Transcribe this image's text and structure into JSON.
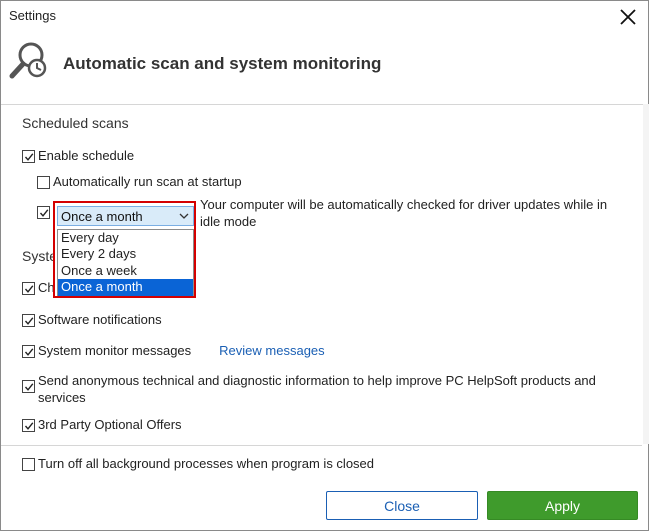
{
  "window": {
    "title": "Settings"
  },
  "header": {
    "title": "Automatic scan and system monitoring",
    "icon": "magnifier-clock-icon"
  },
  "scheduled": {
    "section_title": "Scheduled scans",
    "enable_schedule": {
      "label": "Enable schedule",
      "checked": true
    },
    "run_at_startup": {
      "label": "Automatically run scan at startup",
      "checked": false
    },
    "frequency": {
      "checked": true,
      "selected": "Once a month",
      "options": [
        "Every day",
        "Every 2 days",
        "Once a week",
        "Once a month"
      ],
      "description": "Your computer will be automatically checked for driver updates while in idle mode"
    }
  },
  "system": {
    "section_title_partial": "Syste",
    "row1_partial": "Ch",
    "software_notifications": {
      "label": "Software notifications",
      "checked": true
    },
    "monitor_messages": {
      "label": "System monitor messages",
      "checked": true,
      "link": "Review messages"
    },
    "anonymous_info": {
      "label": "Send anonymous technical and diagnostic information to help improve PC HelpSoft products and services",
      "checked": true
    },
    "third_party": {
      "label": "3rd Party Optional Offers",
      "checked": true
    }
  },
  "footer": {
    "turn_off": {
      "label": "Turn off all background processes when program is closed",
      "checked": false
    },
    "close_label": "Close",
    "apply_label": "Apply"
  },
  "colors": {
    "accent_link": "#1a5fb4",
    "apply_green": "#3f9b2c",
    "selection": "#0a64d6",
    "highlight_border": "#d40000"
  }
}
